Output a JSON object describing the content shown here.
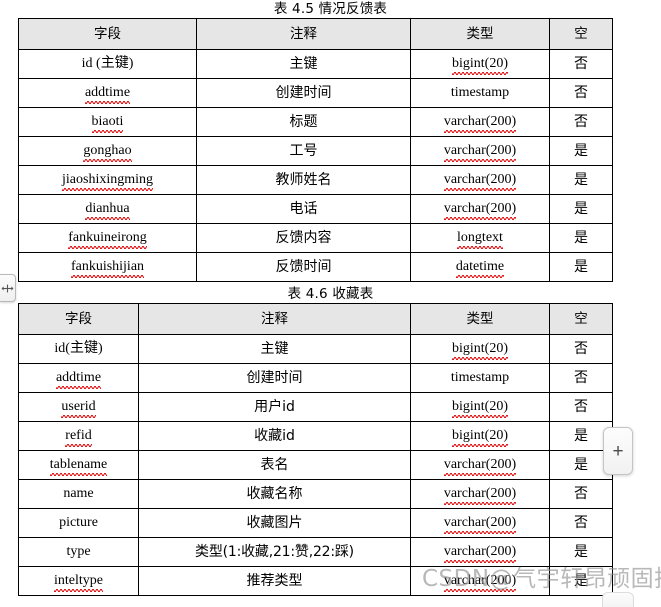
{
  "document": {
    "watermark": "CSDN@气宇轩昂顽固执狂"
  },
  "chrome": {
    "drag_handle_icon": "horizontal-resize-icon",
    "add_button_label": "+",
    "bottom_nub_label": ""
  },
  "tables": [
    {
      "caption": "表 4.5 情况反馈表",
      "headers": [
        "字段",
        "注释",
        "类型",
        "空"
      ],
      "rows": [
        {
          "field": "id (主键)",
          "field_spell": false,
          "comment": "主键",
          "type": "bigint(20)",
          "type_spell": true,
          "nullable": "否"
        },
        {
          "field": "addtime",
          "field_spell": true,
          "comment": "创建时间",
          "type": "timestamp",
          "type_spell": false,
          "nullable": "否"
        },
        {
          "field": "biaoti",
          "field_spell": true,
          "comment": "标题",
          "type": "varchar(200)",
          "type_spell": true,
          "nullable": "否"
        },
        {
          "field": "gonghao",
          "field_spell": true,
          "comment": "工号",
          "type": "varchar(200)",
          "type_spell": true,
          "nullable": "是"
        },
        {
          "field": "jiaoshixingming",
          "field_spell": true,
          "comment": "教师姓名",
          "type": "varchar(200)",
          "type_spell": true,
          "nullable": "是"
        },
        {
          "field": "dianhua",
          "field_spell": true,
          "comment": "电话",
          "type": "varchar(200)",
          "type_spell": true,
          "nullable": "是"
        },
        {
          "field": "fankuineirong",
          "field_spell": true,
          "comment": "反馈内容",
          "type": "longtext",
          "type_spell": true,
          "nullable": "是"
        },
        {
          "field": "fankuishijian",
          "field_spell": true,
          "comment": "反馈时间",
          "type": "datetime",
          "type_spell": true,
          "nullable": "是"
        }
      ]
    },
    {
      "caption": "表 4.6 收藏表",
      "headers": [
        "字段",
        "注释",
        "类型",
        "空"
      ],
      "rows": [
        {
          "field": "id(主键)",
          "field_spell": false,
          "comment": "主键",
          "type": "bigint(20)",
          "type_spell": true,
          "nullable": "否"
        },
        {
          "field": "addtime",
          "field_spell": true,
          "comment": "创建时间",
          "type": "timestamp",
          "type_spell": false,
          "nullable": "否"
        },
        {
          "field": "userid",
          "field_spell": true,
          "comment": "用户id",
          "type": "bigint(20)",
          "type_spell": true,
          "nullable": "否"
        },
        {
          "field": "refid",
          "field_spell": true,
          "comment": "收藏id",
          "type": "bigint(20)",
          "type_spell": true,
          "nullable": "是"
        },
        {
          "field": "tablename",
          "field_spell": true,
          "comment": "表名",
          "type": "varchar(200)",
          "type_spell": true,
          "nullable": "是"
        },
        {
          "field": "name",
          "field_spell": false,
          "comment": "收藏名称",
          "type": "varchar(200)",
          "type_spell": true,
          "nullable": "否"
        },
        {
          "field": "picture",
          "field_spell": false,
          "comment": "收藏图片",
          "type": "varchar(200)",
          "type_spell": true,
          "nullable": "否"
        },
        {
          "field": "type",
          "field_spell": false,
          "comment": "类型(1:收藏,21:赞,22:踩)",
          "type": "varchar(200)",
          "type_spell": true,
          "nullable": "是"
        },
        {
          "field": "inteltype",
          "field_spell": true,
          "comment": "推荐类型",
          "type": "varchar(200)",
          "type_spell": true,
          "nullable": "是"
        }
      ]
    }
  ]
}
